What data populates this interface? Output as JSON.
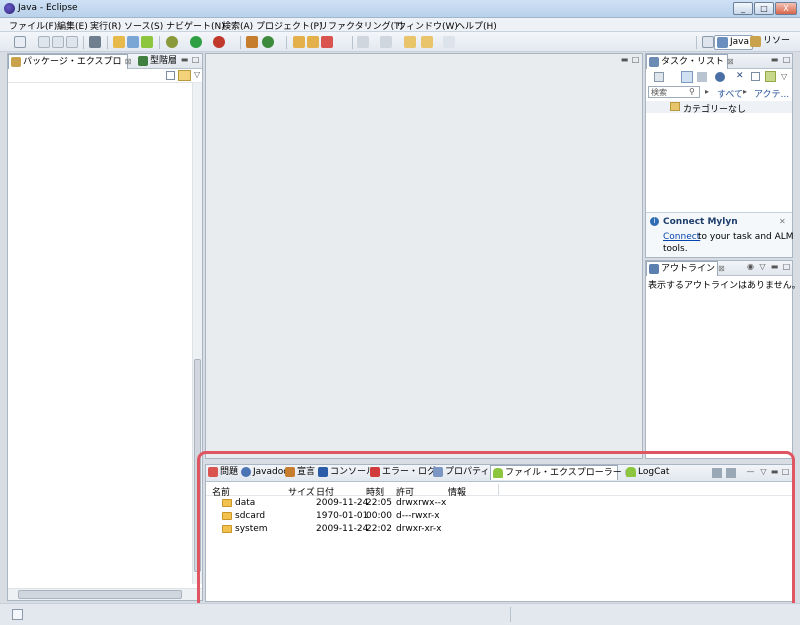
{
  "window": {
    "title": "Java - Eclipse",
    "minimize": "_",
    "maximize": "□",
    "close": "X"
  },
  "menu": [
    "ファイル(F)",
    "編集(E)",
    "実行(R)",
    "ソース(S)",
    "ナビゲート(N)",
    "検索(A)",
    "プロジェクト(P)",
    "リファクタリング(T)",
    "ウィンドウ(W)",
    "ヘルプ(H)"
  ],
  "perspectives": {
    "java": "Java",
    "repository": "リソー"
  },
  "left_panel": {
    "tabs": [
      "パッケージ・エクスプロ",
      "型階層"
    ]
  },
  "task_list": {
    "tab": "タスク・リスト",
    "search_placeholder": "検索",
    "filter_all": "すべて",
    "filter_active": "アクテ...",
    "category": "カテゴリーなし"
  },
  "mylyn": {
    "title": "Connect Mylyn",
    "link": "Connect",
    "text1": "to your task and ALM",
    "text2": "tools."
  },
  "outline": {
    "tab": "アウトライン",
    "message": "表示するアウトラインはありません。"
  },
  "bottom_tabs": [
    "問題",
    "Javadoc",
    "宣言",
    "コンソール",
    "エラー・ログ",
    "プロパティー",
    "ファイル・エクスプローラー",
    "LogCat"
  ],
  "file_explorer": {
    "columns": [
      "名前",
      "サイズ",
      "日付",
      "時刻",
      "許可",
      "情報"
    ],
    "rows": [
      {
        "name": "data",
        "size": "",
        "date": "2009-11-24",
        "time": "22:05",
        "perm": "drwxrwx--x",
        "info": ""
      },
      {
        "name": "sdcard",
        "size": "",
        "date": "1970-01-01",
        "time": "00:00",
        "perm": "d---rwxr-x",
        "info": ""
      },
      {
        "name": "system",
        "size": "",
        "date": "2009-11-24",
        "time": "22:02",
        "perm": "drwxr-xr-x",
        "info": ""
      }
    ]
  },
  "colors": {
    "highlight": "#e05562",
    "title_gradient": "#b9d1ea",
    "android_green": "#8cc63f"
  }
}
